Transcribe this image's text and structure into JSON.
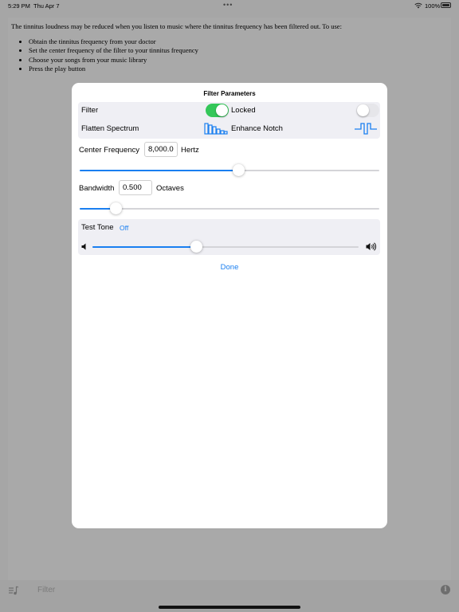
{
  "status_bar": {
    "time": "5:29 PM",
    "date": "Thu Apr 7",
    "battery": "100%"
  },
  "document": {
    "intro": "The tinnitus loudness may be reduced when you listen to music where the tinnitus frequency has been filtered out. To use:",
    "steps": [
      "Obtain the tinnitus frequency from your doctor",
      "Set the center frequency of the filter to your tinnitus frequency",
      "Choose your songs from your music library",
      "Press the play button"
    ]
  },
  "modal": {
    "title": "Filter Parameters",
    "filter_label": "Filter",
    "filter_on": true,
    "locked_label": "Locked",
    "locked_on": false,
    "flatten_label": "Flatten Spectrum",
    "flatten_icon": "flatten-spectrum-icon",
    "enhance_label": "Enhance Notch",
    "enhance_icon": "enhance-notch-icon",
    "center_frequency": {
      "label": "Center Frequency",
      "value": "8,000.0",
      "unit": "Hertz",
      "slider_fraction": 0.53
    },
    "bandwidth": {
      "label": "Bandwidth",
      "value": "0.500",
      "unit": "Octaves",
      "slider_fraction": 0.12
    },
    "test_tone": {
      "label": "Test Tone",
      "state": "Off",
      "volume_fraction": 0.39,
      "min_icon": "volume-min-icon",
      "max_icon": "volume-max-icon"
    },
    "done_label": "Done"
  },
  "toolbar": {
    "songs_icon": "music-list-icon",
    "filter_label": "Filter",
    "info_icon": "info-icon"
  },
  "colors": {
    "accent": "#1a7ff0",
    "toggle_on": "#34c759",
    "toggle_off": "#e6e6ea",
    "overlay": "#a6a6a6"
  }
}
